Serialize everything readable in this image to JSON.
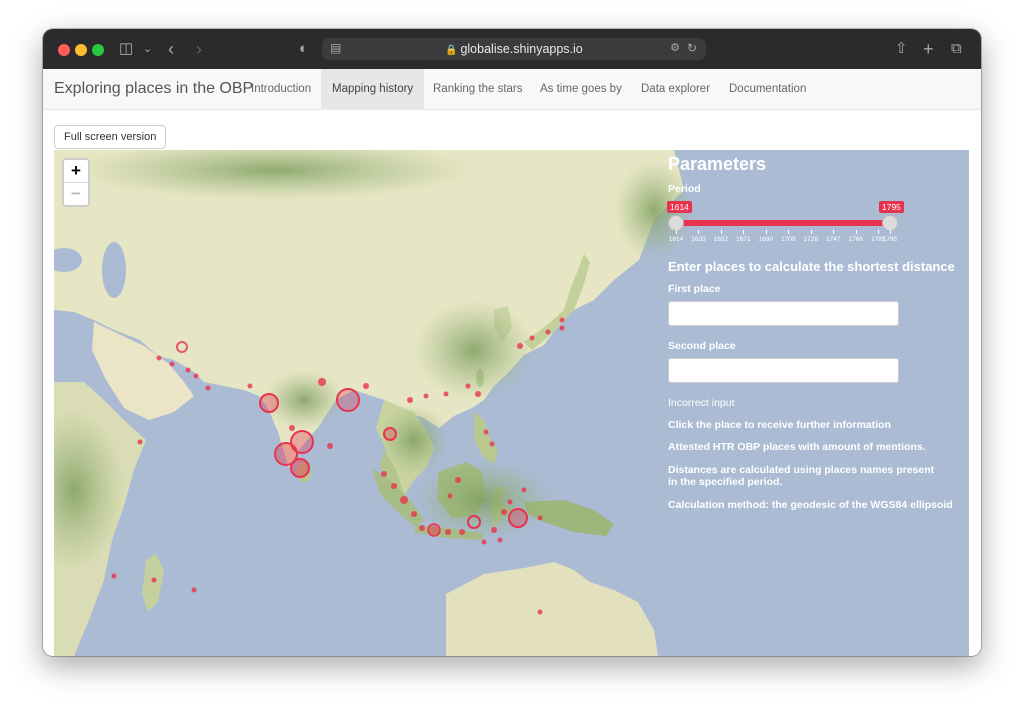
{
  "browser": {
    "url": "globalise.shinyapps.io"
  },
  "navbar": {
    "brand": "Exploring places in the OBP",
    "tabs": [
      {
        "label": "Introduction"
      },
      {
        "label": "Mapping history"
      },
      {
        "label": "Ranking the stars"
      },
      {
        "label": "As time goes by"
      },
      {
        "label": "Data explorer"
      },
      {
        "label": "Documentation"
      }
    ],
    "active_tab": "Mapping history"
  },
  "full_screen_label": "Full screen version",
  "map": {
    "zoom_in": "+",
    "zoom_out": "−"
  },
  "panel": {
    "title": "Parameters",
    "period_label": "Period",
    "period_min": "1614",
    "period_max": "1795",
    "period_ticks": [
      "1614",
      "1633",
      "1652",
      "1671",
      "1690",
      "1709",
      "1728",
      "1747",
      "1766",
      "1785",
      "1795"
    ],
    "distance_heading": "Enter places to calculate the shortest distance",
    "first_place_label": "First place",
    "second_place_label": "Second place",
    "incorrect_input": "Incorrect input",
    "info_click": "Click the place to receive further information",
    "info_attested": "Attested HTR OBP places with amount of mentions.",
    "info_distances_1": "Distances are calculated using places names present",
    "info_distances_2": "in the specified period.",
    "info_method": "Calculation method: the geodesic of the WGS84 ellipsoid"
  },
  "colors": {
    "marker": "#e8334f",
    "ocean": "#aabbd3",
    "land": "#e6e6c4",
    "vegetation": "#8fae70"
  }
}
